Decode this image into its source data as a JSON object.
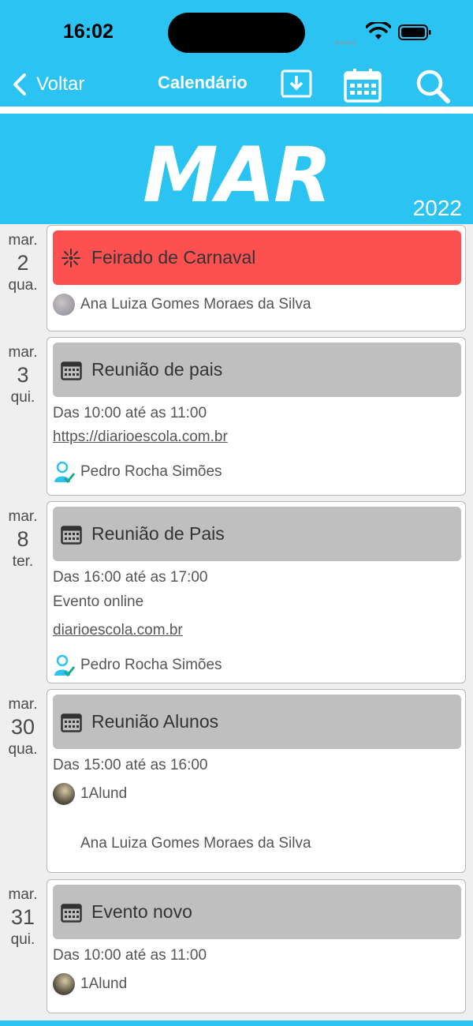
{
  "status": {
    "time": "16:02"
  },
  "nav": {
    "back_label": "Voltar",
    "title": "Calendário",
    "icons": [
      "download-icon",
      "calendar-icon",
      "search-icon"
    ]
  },
  "header": {
    "month": "MAR",
    "year": "2022"
  },
  "colors": {
    "primary": "#2bc3f2",
    "holiday": "#fd5050",
    "event": "#bfbfbf"
  },
  "events": [
    {
      "day": {
        "month": "mar.",
        "number": "2",
        "weekday": "qua."
      },
      "title": "Feirado de Carnaval",
      "icon": "fireworks-icon",
      "people": [
        "Ana Luiza Gomes Moraes da Silva"
      ]
    },
    {
      "day": {
        "month": "mar.",
        "number": "3",
        "weekday": "qui."
      },
      "title": "Reunião de pais",
      "icon": "calendar-icon",
      "time": "Das 10:00 até as 11:00",
      "link": "https://diarioescola.com.br",
      "people": [
        "Pedro Rocha Simões"
      ]
    },
    {
      "day": {
        "month": "mar.",
        "number": "8",
        "weekday": "ter."
      },
      "title": "Reunião de Pais",
      "icon": "calendar-icon",
      "time": "Das 16:00 até as 17:00",
      "note": "Evento online",
      "link": "diarioescola.com.br",
      "people": [
        "Pedro Rocha Simões"
      ]
    },
    {
      "day": {
        "month": "mar.",
        "number": "30",
        "weekday": "qua."
      },
      "title": "Reunião Alunos",
      "icon": "calendar-icon",
      "time": "Das 15:00 até as 16:00",
      "people": [
        "1Alund",
        "Ana Luiza Gomes Moraes da Silva"
      ]
    },
    {
      "day": {
        "month": "mar.",
        "number": "31",
        "weekday": "qui."
      },
      "title": "Evento novo",
      "icon": "calendar-icon",
      "time": "Das 10:00 até as 11:00",
      "people": [
        "1Alund"
      ]
    }
  ]
}
